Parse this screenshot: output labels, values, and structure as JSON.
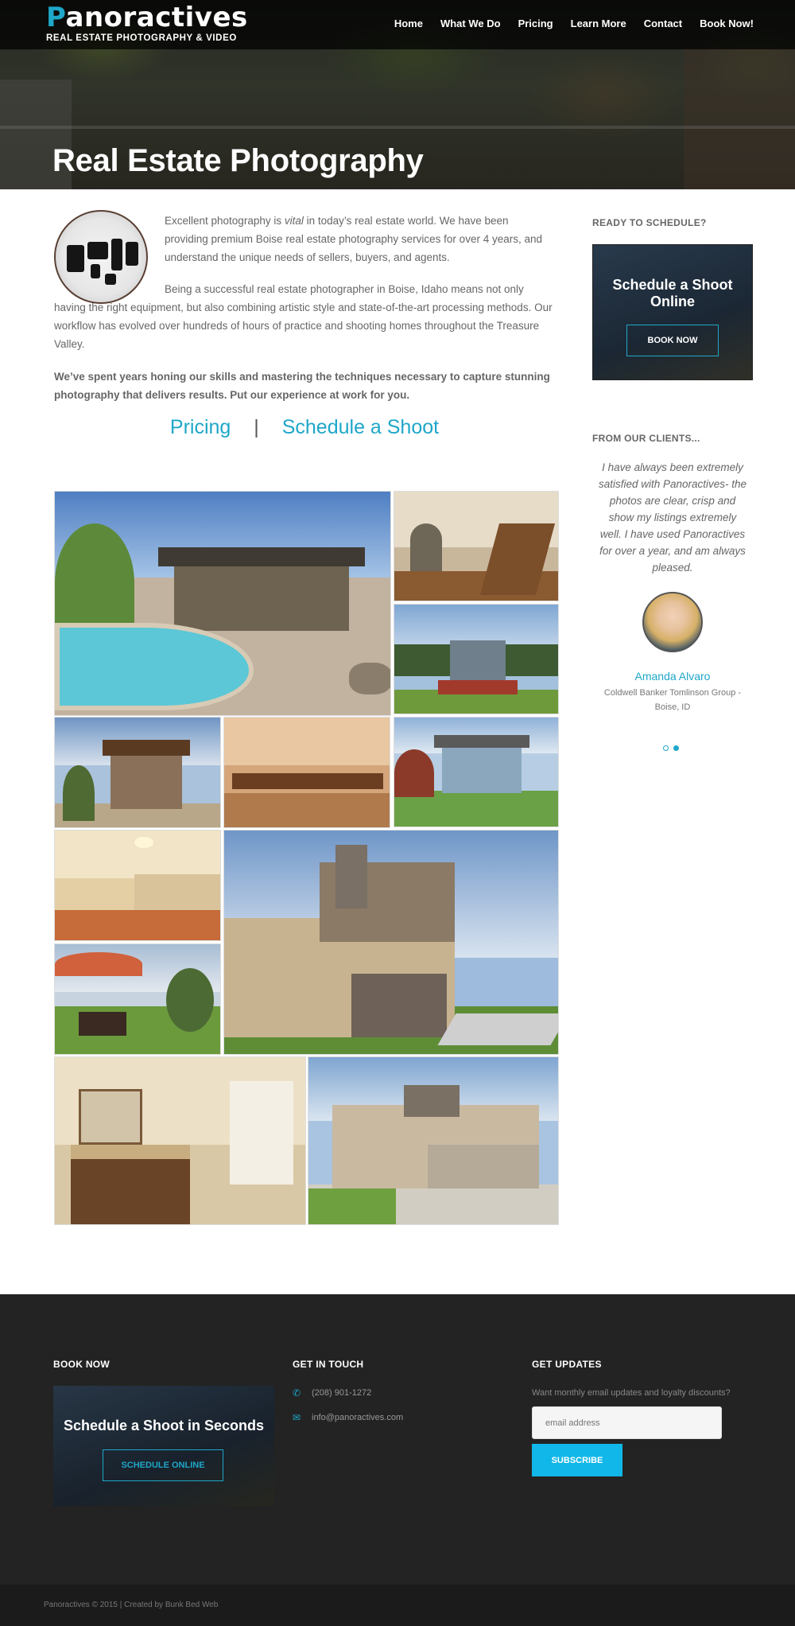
{
  "header": {
    "logo_main": "anoractives",
    "logo_initial": "P",
    "logo_sub": "REAL ESTATE PHOTOGRAPHY & VIDEO",
    "nav": [
      "Home",
      "What We Do",
      "Pricing",
      "Learn More",
      "Contact",
      "Book Now!"
    ]
  },
  "hero": {
    "title": "Real Estate Photography"
  },
  "main": {
    "p1_before": "Excellent photography is ",
    "p1_em": "vital",
    "p1_after": " in today’s real estate world. We have been providing premium Boise real estate photography services for over 4 years, and understand the unique needs of sellers, buyers, and agents.",
    "p2": "Being a successful real estate photographer in Boise, Idaho means not only having the right equipment, but also combining artistic style and state-of-the-art processing methods. Our workflow has evolved over hundreds of hours of practice and shooting homes throughout the Treasure Valley.",
    "p3": "We’ve spent years honing our skills and mastering the techniques necessary to capture stunning photography that delivers results. Put our experience at work for you.",
    "link_pricing": "Pricing",
    "link_sep": "|",
    "link_schedule": "Schedule a Shoot"
  },
  "sidebar": {
    "ready_heading": "READY TO SCHEDULE?",
    "card_title": "Schedule a Shoot Online",
    "card_button": "BOOK NOW",
    "clients_heading": "FROM OUR CLIENTS...",
    "quote": "I have always been extremely satisfied with Panoractives- the photos are clear, crisp and show my listings extremely well. I have used Panoractives for over a year, and am always pleased.",
    "client_name": "Amanda Alvaro",
    "client_org": "Coldwell Banker Tomlinson Group - Boise, ID"
  },
  "footer": {
    "book_heading": "BOOK NOW",
    "book_card_title": "Schedule a Shoot in Seconds",
    "book_card_button": "SCHEDULE ONLINE",
    "touch_heading": "GET IN TOUCH",
    "phone": "(208) 901-1272",
    "email": "info@panoractives.com",
    "updates_heading": "GET UPDATES",
    "updates_text": "Want monthly email updates and loyalty discounts?",
    "email_placeholder": "email address",
    "subscribe_label": "SUBSCRIBE",
    "copyright": "Panoractives © 2015 | Created by Bunk Bed Web"
  },
  "colors": {
    "accent": "#1ea7c8",
    "footer_bg": "#232323",
    "subscribe_bg": "#11b7e8"
  },
  "icons": [
    "phone-icon",
    "envelope-icon"
  ]
}
